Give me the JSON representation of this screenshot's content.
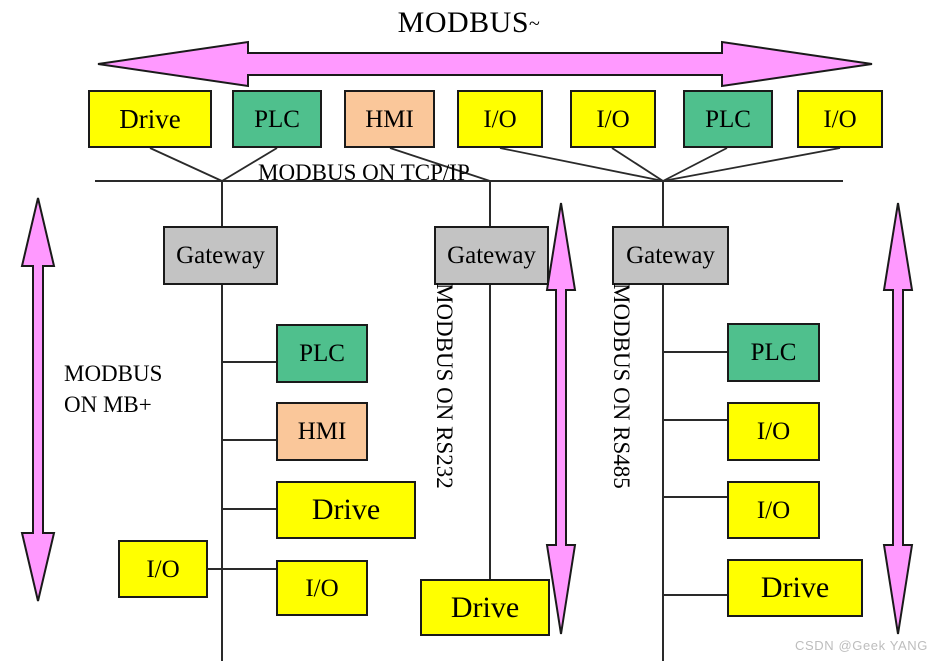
{
  "diagram": {
    "title": "MODBUS",
    "title_mark": "~",
    "watermark": "CSDN @Geek YANG",
    "colors": {
      "yellow": "#ffff00",
      "green": "#4FC08D",
      "peach": "#FAC79A",
      "gray": "#C3C3C3",
      "arrow_pink": "#FF99FF",
      "line_black": "#1a1a1a",
      "watermark_gray": "#bdbdbd"
    }
  },
  "bus_labels": {
    "tcpip": "MODBUS ON TCP/IP",
    "mbplus": "MODBUS ON MB+",
    "mbplus_line1": "MODBUS",
    "mbplus_line2": "ON MB+",
    "rs232": "MODBUS ON RS232",
    "rs485": "MODBUS ON RS485"
  },
  "arrows": {
    "top": {
      "name": "modbus-bus-arrow",
      "direction": "bidirectional-horizontal"
    },
    "left": {
      "name": "mbplus-bus-arrow",
      "direction": "bidirectional-vertical"
    },
    "middle": {
      "name": "rs232-bus-arrow",
      "direction": "bidirectional-vertical"
    },
    "right": {
      "name": "rs485-bus-arrow",
      "direction": "bidirectional-vertical"
    }
  },
  "top_row": [
    {
      "label": "Drive",
      "color": "yellow"
    },
    {
      "label": "PLC",
      "color": "green"
    },
    {
      "label": "HMI",
      "color": "peach"
    },
    {
      "label": "I/O",
      "color": "yellow"
    },
    {
      "label": "I/O",
      "color": "yellow"
    },
    {
      "label": "PLC",
      "color": "green"
    },
    {
      "label": "I/O",
      "color": "yellow"
    }
  ],
  "gateways": [
    {
      "label": "Gateway",
      "bus": "MODBUS ON MB+"
    },
    {
      "label": "Gateway",
      "bus": "MODBUS ON RS232"
    },
    {
      "label": "Gateway",
      "bus": "MODBUS ON RS485"
    }
  ],
  "mbplus_devices": [
    {
      "label": "PLC",
      "color": "green"
    },
    {
      "label": "HMI",
      "color": "peach"
    },
    {
      "label": "Drive",
      "color": "yellow"
    },
    {
      "label": "I/O",
      "color": "yellow"
    },
    {
      "label": "I/O",
      "color": "yellow"
    }
  ],
  "rs232_devices": [
    {
      "label": "Drive",
      "color": "yellow"
    }
  ],
  "rs485_devices": [
    {
      "label": "PLC",
      "color": "green"
    },
    {
      "label": "I/O",
      "color": "yellow"
    },
    {
      "label": "I/O",
      "color": "yellow"
    },
    {
      "label": "Drive",
      "color": "yellow"
    }
  ]
}
